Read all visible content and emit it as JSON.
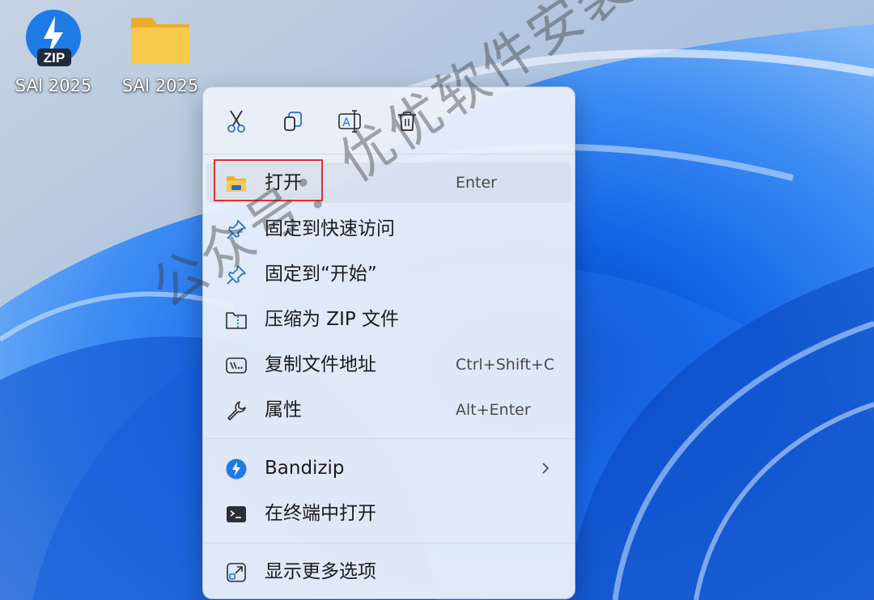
{
  "desktop": {
    "icons": [
      {
        "label": "SAI 2025",
        "badge": "ZIP",
        "icon": "bandizip-archive-icon"
      },
      {
        "label": "SAI 2025",
        "icon": "folder-icon"
      }
    ]
  },
  "context_menu": {
    "quick_actions": [
      {
        "name": "cut",
        "icon": "scissors-icon"
      },
      {
        "name": "copy",
        "icon": "copy-icon"
      },
      {
        "name": "rename",
        "icon": "rename-icon"
      },
      {
        "name": "delete",
        "icon": "trash-icon"
      }
    ],
    "items": [
      {
        "label": "打开",
        "shortcut": "Enter",
        "icon": "folder-open-icon",
        "highlighted": true
      },
      {
        "label": "固定到快速访问",
        "shortcut": "",
        "icon": "pin-icon"
      },
      {
        "label": "固定到“开始”",
        "shortcut": "",
        "icon": "pin-icon"
      },
      {
        "label": "压缩为 ZIP 文件",
        "shortcut": "",
        "icon": "zip-folder-icon"
      },
      {
        "label": "复制文件地址",
        "shortcut": "Ctrl+Shift+C",
        "icon": "copy-path-icon"
      },
      {
        "label": "属性",
        "shortcut": "Alt+Enter",
        "icon": "wrench-icon"
      },
      {
        "label": "Bandizip",
        "shortcut": "",
        "icon": "bandizip-icon",
        "submenu": true
      },
      {
        "label": "在终端中打开",
        "shortcut": "",
        "icon": "terminal-icon"
      },
      {
        "label": "显示更多选项",
        "shortcut": "",
        "icon": "show-more-icon"
      }
    ]
  },
  "watermark": "公众号：优优软件安装",
  "colors": {
    "accent": "#0a64d8",
    "highlight_border": "#e03030",
    "folder": "#f8c94a"
  }
}
